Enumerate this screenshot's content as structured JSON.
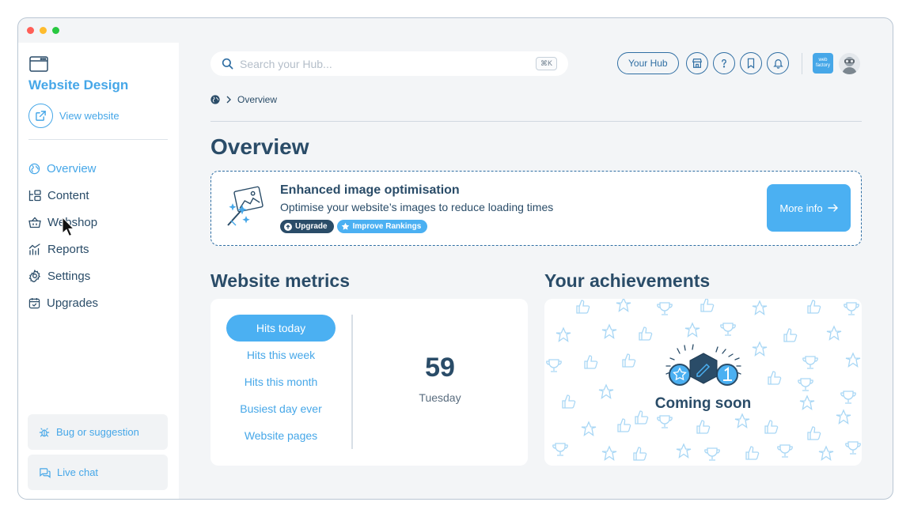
{
  "window": {
    "traffic_colors": [
      "#ff5f57",
      "#febc2e",
      "#28c840"
    ]
  },
  "sidebar": {
    "site_title": "Website Design",
    "view_website": "View website",
    "items": [
      {
        "label": "Overview",
        "icon": "globe-icon",
        "active": true
      },
      {
        "label": "Content",
        "icon": "layout-icon",
        "active": false
      },
      {
        "label": "Webshop",
        "icon": "basket-icon",
        "active": false
      },
      {
        "label": "Reports",
        "icon": "chart-icon",
        "active": false
      },
      {
        "label": "Settings",
        "icon": "gear-icon",
        "active": false
      },
      {
        "label": "Upgrades",
        "icon": "calendar-icon",
        "active": false
      }
    ],
    "bug_label": "Bug or suggestion",
    "chat_label": "Live chat"
  },
  "header": {
    "search_placeholder": "Search your Hub...",
    "shortcut": "⌘K",
    "hub_button": "Your Hub",
    "icons": [
      "store-icon",
      "help-icon",
      "bookmark-icon",
      "bell-icon"
    ],
    "brand_line1": "web",
    "brand_line2": "factory"
  },
  "breadcrumb": {
    "current": "Overview"
  },
  "page_title": "Overview",
  "promo": {
    "title": "Enhanced image optimisation",
    "subtitle": "Optimise your website’s images to reduce loading times",
    "badge_upgrade": "Upgrade",
    "badge_rankings": "Improve Rankings",
    "more_info": "More info"
  },
  "metrics": {
    "title": "Website metrics",
    "tabs": [
      "Hits today",
      "Hits this week",
      "Hits this month",
      "Busiest day ever",
      "Website pages"
    ],
    "active_tab": 0,
    "value": "59",
    "caption": "Tuesday"
  },
  "achievements": {
    "title": "Your achievements",
    "status": "Coming soon"
  },
  "colors": {
    "accent": "#46a7e8",
    "button": "#4bb0f2",
    "navy": "#2a4c68",
    "dark_blue": "#2f6ea3",
    "badge_dark": "#2a4c68"
  }
}
